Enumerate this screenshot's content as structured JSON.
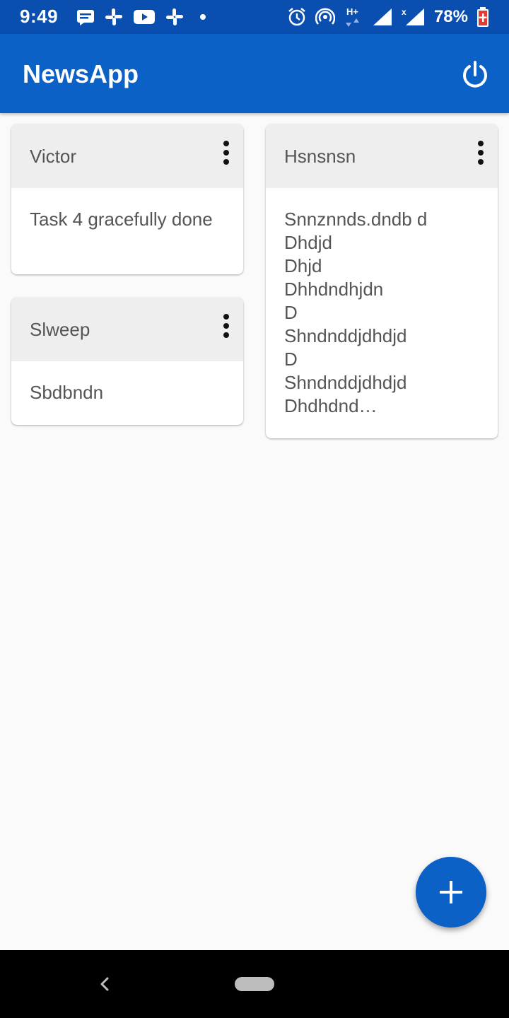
{
  "status_bar": {
    "time": "9:49",
    "battery_percent": "78%",
    "left_icons": [
      "message-icon",
      "slack-icon",
      "youtube-icon",
      "slack-icon",
      "dot-icon"
    ],
    "right_icons": [
      "alarm-icon",
      "hotspot-icon",
      "hplus-data-icon",
      "signal-icon",
      "signal-x-icon",
      "battery-icon"
    ]
  },
  "app_bar": {
    "title": "NewsApp",
    "power_icon": "power-icon",
    "color": "#0b61c6"
  },
  "cards": [
    {
      "title": "Victor",
      "body": "Task 4 gracefully done"
    },
    {
      "title": "Slweep",
      "body": "Sbdbndn"
    },
    {
      "title": "Hsnsnsn",
      "body_lines": [
        "Snnznnds.dndb d",
        "Dhdjd",
        "Dhjd",
        "Dhhdndhjdn",
        "D",
        "Shndnddjdhdjd",
        "D",
        "Shndnddjdhdjd",
        "Dhdhdnd…"
      ]
    }
  ],
  "fab": {
    "icon": "plus-icon"
  },
  "nav": {
    "back_icon": "back-icon",
    "home_icon": "home-pill-icon"
  }
}
